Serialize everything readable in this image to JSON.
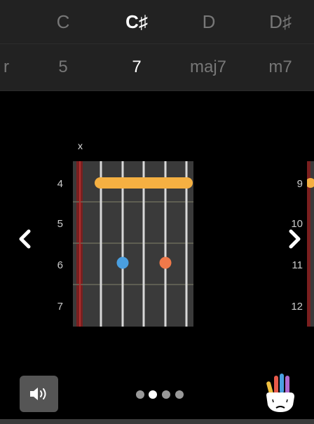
{
  "root_notes": [
    {
      "label": "C"
    },
    {
      "label": "C♯"
    },
    {
      "label": "D"
    },
    {
      "label": "D♯"
    }
  ],
  "selected_root": "C♯",
  "chord_types": [
    {
      "label": "r"
    },
    {
      "label": "5"
    },
    {
      "label": "7"
    },
    {
      "label": "maj7"
    },
    {
      "label": "m7"
    }
  ],
  "selected_type": "7",
  "diagram": {
    "mute_marker": "x",
    "fret_numbers": [
      "4",
      "5",
      "6",
      "7"
    ],
    "colors": {
      "barre": "#f5b042",
      "dot_blue": "#4a9fe0",
      "dot_orange": "#f0794a",
      "fretboard": "#3a3a3a",
      "nut": "#7a1f1f"
    }
  },
  "next_diagram": {
    "fret_numbers": [
      "9",
      "10",
      "11",
      "12"
    ]
  },
  "icons": {
    "prev": "chevron-left-icon",
    "next": "chevron-right-icon",
    "sound": "speaker-icon",
    "hand": "hand-icon"
  },
  "pagination": {
    "total": 4,
    "active": 1
  }
}
